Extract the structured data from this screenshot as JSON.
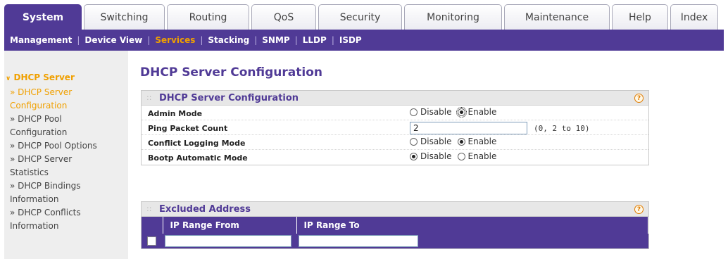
{
  "top_tabs": [
    {
      "label": "System",
      "active": true
    },
    {
      "label": "Switching",
      "active": false
    },
    {
      "label": "Routing",
      "active": false
    },
    {
      "label": "QoS",
      "active": false
    },
    {
      "label": "Security",
      "active": false
    },
    {
      "label": "Monitoring",
      "active": false
    },
    {
      "label": "Maintenance",
      "active": false
    },
    {
      "label": "Help",
      "active": false
    },
    {
      "label": "Index",
      "active": false
    }
  ],
  "sub_nav": [
    {
      "label": "Management",
      "active": false
    },
    {
      "label": "Device View",
      "active": false
    },
    {
      "label": "Services",
      "active": true
    },
    {
      "label": "Stacking",
      "active": false
    },
    {
      "label": "SNMP",
      "active": false
    },
    {
      "label": "LLDP",
      "active": false
    },
    {
      "label": "ISDP",
      "active": false
    }
  ],
  "left_nav": {
    "section": "DHCP Server",
    "items": [
      {
        "label": "» DHCP Server",
        "active": true
      },
      {
        "label": "Configuration",
        "active": true
      },
      {
        "label": "» DHCP Pool",
        "active": false
      },
      {
        "label": "Configuration",
        "active": false
      },
      {
        "label": "» DHCP Pool Options",
        "active": false
      },
      {
        "label": "» DHCP Server",
        "active": false
      },
      {
        "label": "Statistics",
        "active": false
      },
      {
        "label": "» DHCP Bindings",
        "active": false
      },
      {
        "label": "Information",
        "active": false
      },
      {
        "label": "» DHCP Conflicts",
        "active": false
      },
      {
        "label": "Information",
        "active": false
      }
    ]
  },
  "page_title": "DHCP Server Configuration",
  "config_panel": {
    "title": "DHCP Server Configuration",
    "help": "?",
    "admin_mode": {
      "label": "Admin Mode",
      "disable": "Disable",
      "enable": "Enable",
      "selected": "enable"
    },
    "ping_packet_count": {
      "label": "Ping Packet Count",
      "value": "2",
      "hint": "(0, 2 to 10)"
    },
    "conflict_logging_mode": {
      "label": "Conflict Logging Mode",
      "disable": "Disable",
      "enable": "Enable",
      "selected": "enable"
    },
    "bootp_automatic_mode": {
      "label": "Bootp Automatic Mode",
      "disable": "Disable",
      "enable": "Enable",
      "selected": "disable"
    }
  },
  "excluded_panel": {
    "title": "Excluded Address",
    "help": "?",
    "columns": [
      "IP Range From",
      "IP Range To"
    ],
    "row": {
      "from": "",
      "to": ""
    }
  },
  "colors": {
    "brand": "#503a96",
    "accent": "#f0a000"
  },
  "icons": {
    "help": "help-circle-icon",
    "grip": "grip-icon",
    "arrow": "chevron-down-icon"
  }
}
